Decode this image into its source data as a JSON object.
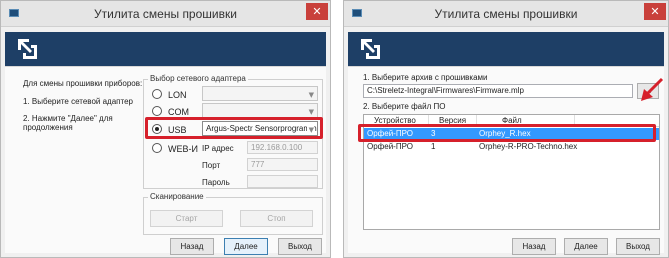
{
  "window1": {
    "title": "Утилита смены прошивки",
    "instructions": {
      "heading": "Для смены прошивки приборов:",
      "step1": "1. Выберите сетевой адаптер",
      "step2_line1": "2. Нажмите \"Далее\" для",
      "step2_line2": "продолжения"
    },
    "adapter_group": {
      "title": "Выбор сетевого адаптера",
      "options": [
        {
          "label": "LON",
          "selected": false
        },
        {
          "label": "COM",
          "selected": false
        },
        {
          "label": "USB",
          "selected": true
        },
        {
          "label": "WEB-И",
          "selected": false
        }
      ],
      "usb_device": "Argus-Spectr Sensorprogrammer",
      "ip_label": "IP адрес",
      "ip_value": "192.168.0.100",
      "port_label": "Порт",
      "port_value": "777",
      "password_label": "Пароль",
      "password_value": ""
    },
    "scan_group": {
      "title": "Сканирование",
      "start_label": "Старт",
      "stop_label": "Стоп"
    },
    "buttons": {
      "back": "Назад",
      "next": "Далее",
      "exit": "Выход"
    }
  },
  "window2": {
    "title": "Утилита смены прошивки",
    "step1_label": "1. Выберите архив с прошивками",
    "archive_path": "C:\\Streletz-Integral\\Firmwares\\Firmware.mlp",
    "browse_label": "...",
    "step2_label": "2. Выберите файл ПО",
    "table": {
      "columns": [
        "Устройство",
        "Версия",
        "Файл"
      ],
      "rows": [
        {
          "device": "Орфей-ПРО",
          "version": "3",
          "file": "Orphey_R.hex",
          "selected": true
        },
        {
          "device": "Орфей-ПРО",
          "version": "1",
          "file": "Orphey-R-PRO-Techno.hex",
          "selected": false
        }
      ]
    },
    "buttons": {
      "back": "Назад",
      "next": "Далее",
      "exit": "Выход"
    }
  },
  "colors": {
    "banner": "#1e3f66",
    "highlight": "#d6202b",
    "selection": "#3399ff",
    "close": "#c9403b"
  }
}
